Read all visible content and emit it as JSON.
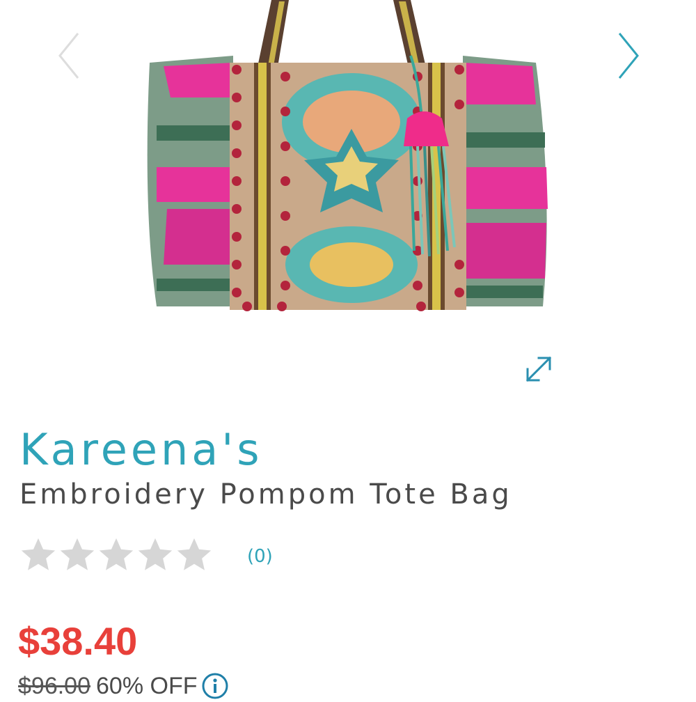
{
  "carousel": {
    "prev_icon": "chevron-left-icon",
    "next_icon": "chevron-right-icon",
    "expand_icon": "expand-arrows-icon"
  },
  "product": {
    "brand": "Kareena's",
    "name": "Embroidery Pompom Tote Bag",
    "rating": 0,
    "rating_max": 5,
    "review_count": "(0)",
    "price": "$38.40",
    "original_price": "$96.00",
    "discount": "60% OFF",
    "info_icon": "info-circle-icon"
  },
  "colors": {
    "accent": "#2fa3b8",
    "price": "#e8403a",
    "star_empty": "#d6d6d6",
    "text": "#4a4a4a"
  }
}
